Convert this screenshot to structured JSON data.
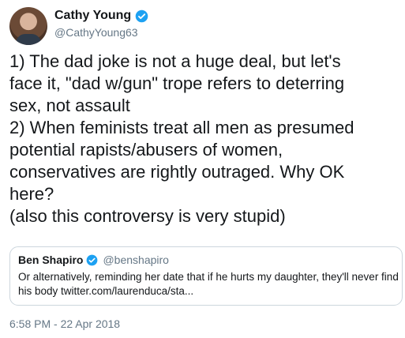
{
  "author": {
    "name": "Cathy Young",
    "handle": "@CathyYoung63",
    "verified_icon": "verified-badge-icon"
  },
  "tweet": {
    "lines": [
      "1) The dad joke is not a huge deal, but let's",
      "face it, \"dad w/gun\" trope refers to deterring",
      "sex, not assault",
      "2) When feminists treat all men as presumed",
      "potential rapists/abusers of women,",
      "conservatives are rightly outraged. Why OK",
      "here?",
      "(also this controversy is very stupid)"
    ]
  },
  "quoted": {
    "name": "Ben Shapiro",
    "handle": "@benshapiro",
    "lines": [
      "Or alternatively, reminding her date that if he hurts my daughter, they'll never find",
      "his body twitter.com/laurenduca/sta..."
    ]
  },
  "timestamp": "6:58 PM - 22 Apr 2018",
  "colors": {
    "verified": "#1da1f2",
    "muted": "#657786",
    "border": "#ccd6dd"
  }
}
